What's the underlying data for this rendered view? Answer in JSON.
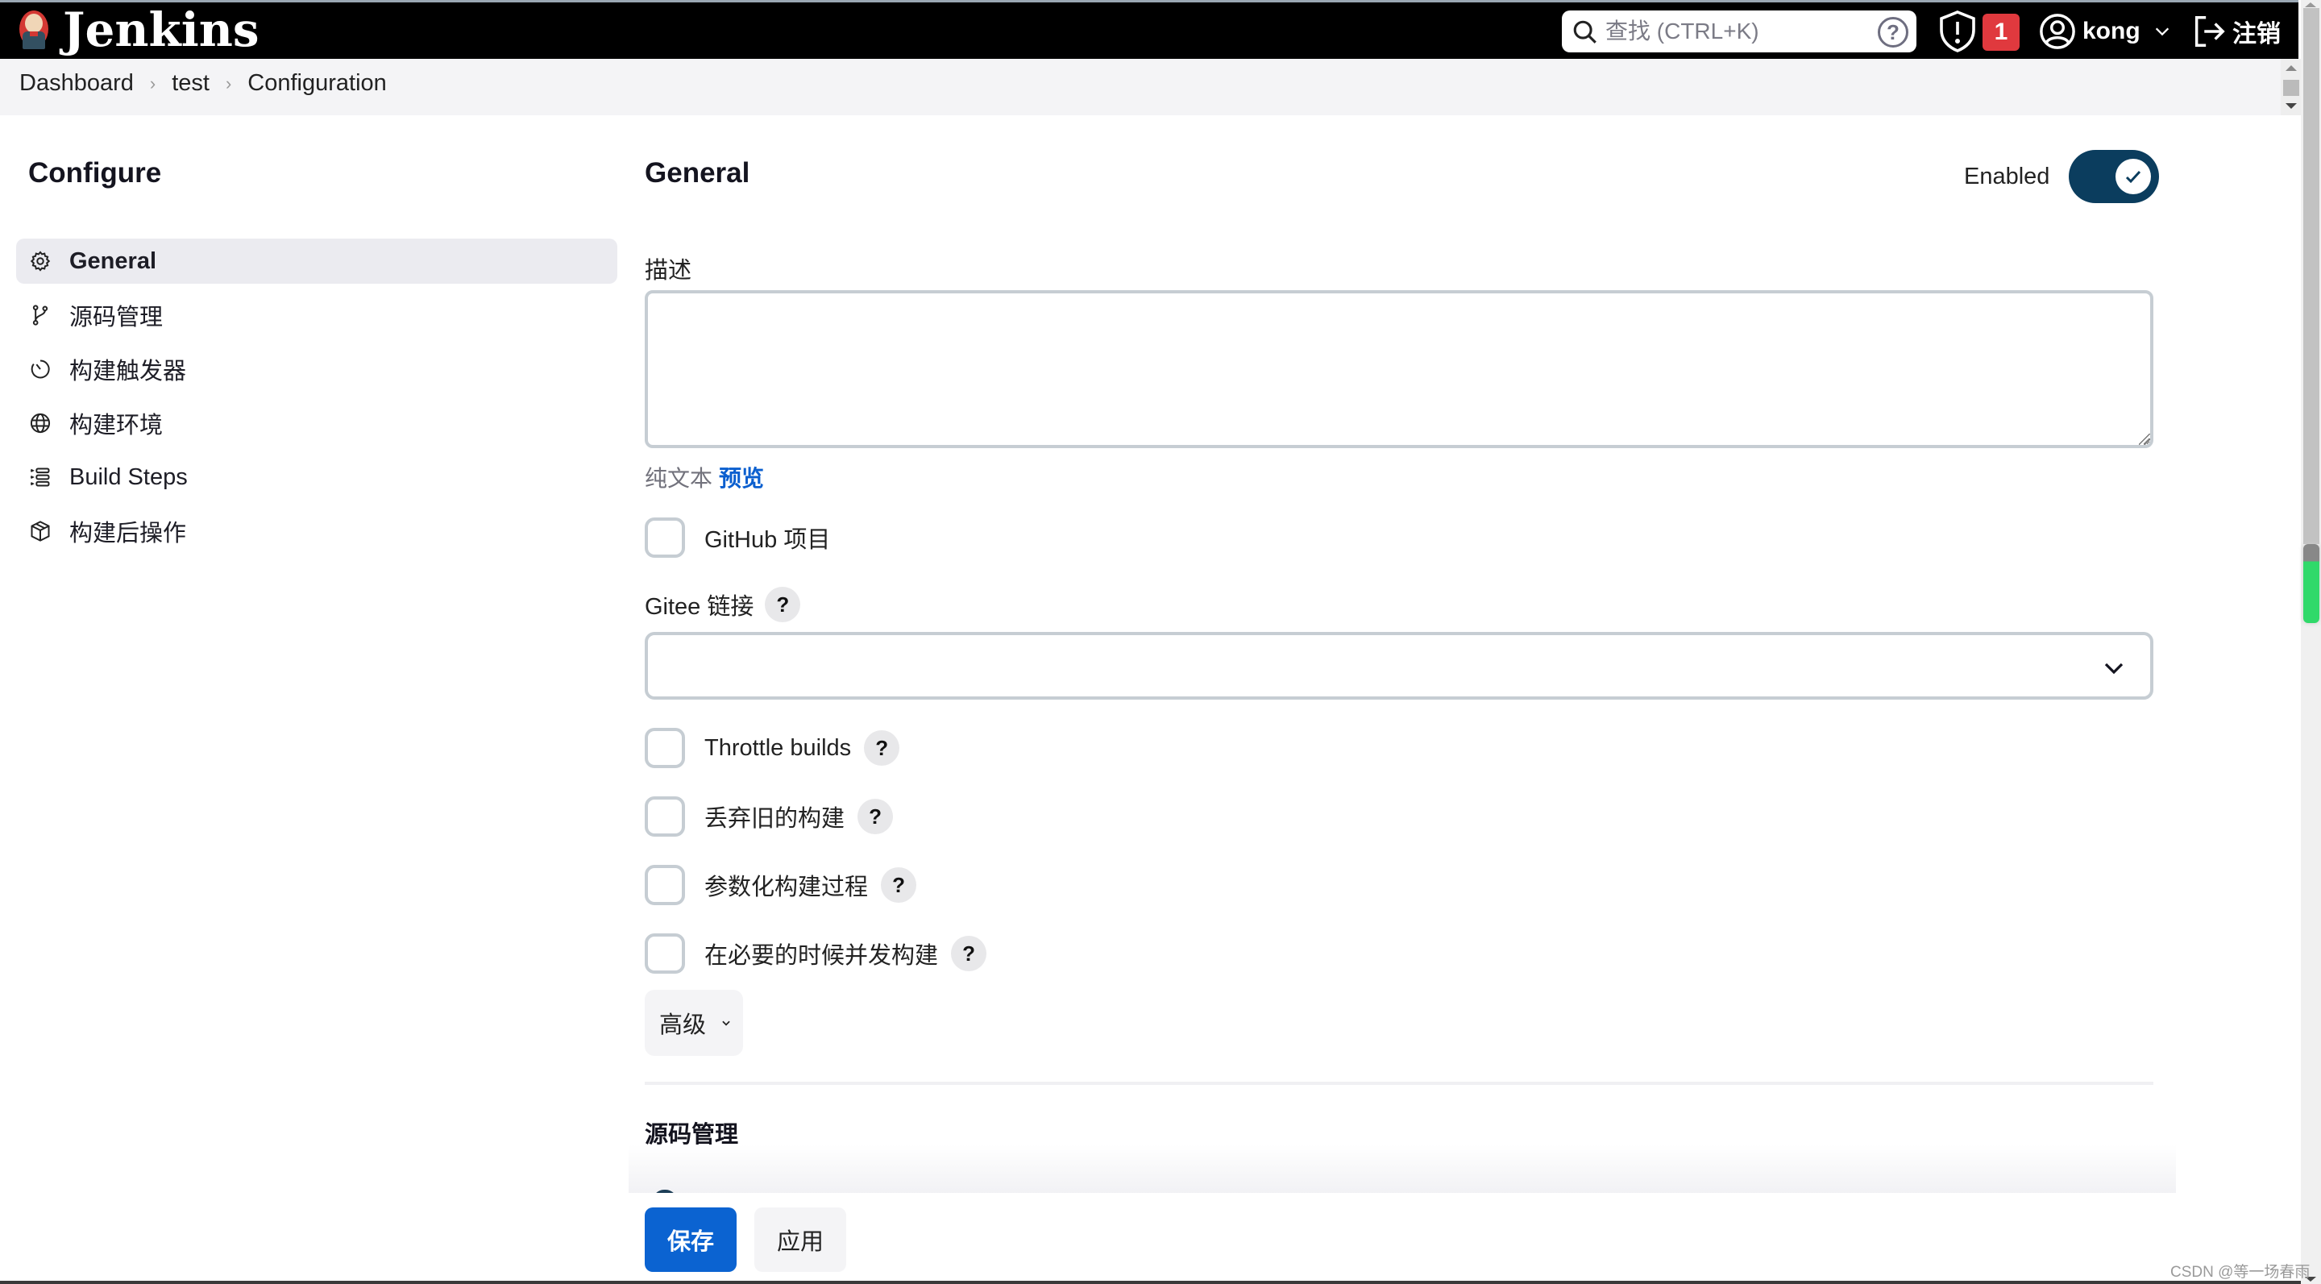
{
  "header": {
    "app_name": "Jenkins",
    "search_placeholder": "查找 (CTRL+K)",
    "search_help": "?",
    "security_badge_count": "1",
    "username": "kong",
    "logout_label": "注销"
  },
  "breadcrumb": [
    "Dashboard",
    "test",
    "Configuration"
  ],
  "sidebar": {
    "title": "Configure",
    "items": [
      {
        "label": "General",
        "icon": "gear-icon",
        "active": true
      },
      {
        "label": "源码管理",
        "icon": "branch-icon",
        "active": false
      },
      {
        "label": "构建触发器",
        "icon": "timer-icon",
        "active": false
      },
      {
        "label": "构建环境",
        "icon": "globe-icon",
        "active": false
      },
      {
        "label": "Build Steps",
        "icon": "list-icon",
        "active": false
      },
      {
        "label": "构建后操作",
        "icon": "package-icon",
        "active": false
      }
    ]
  },
  "general": {
    "title": "General",
    "enabled_label": "Enabled",
    "enabled": true,
    "description_label": "描述",
    "description_value": "",
    "format_plain": "纯文本",
    "format_preview": "预览",
    "github_project_label": "GitHub 项目",
    "gitee_label": "Gitee 链接",
    "gitee_selected": "",
    "options": [
      {
        "label": "Throttle builds",
        "checked": false
      },
      {
        "label": "丢弃旧的构建",
        "checked": false
      },
      {
        "label": "参数化构建过程",
        "checked": false
      },
      {
        "label": "在必要的时候并发构建",
        "checked": false
      }
    ],
    "help_label": "?",
    "advanced_label": "高级"
  },
  "scm": {
    "title": "源码管理"
  },
  "actions": {
    "save_label": "保存",
    "apply_label": "应用"
  },
  "watermark": "CSDN @等一场春雨"
}
